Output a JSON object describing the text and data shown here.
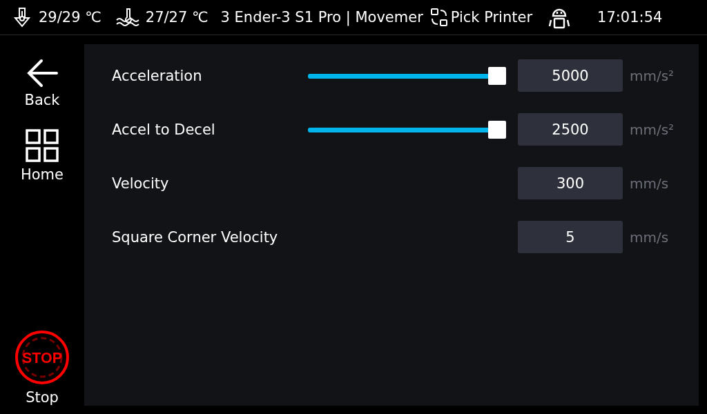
{
  "status_bar": {
    "extruder_temp": "29/29 ℃",
    "bed_temp": "27/27 ℃",
    "title": "3 Ender-3 S1 Pro | Movemer",
    "pick_printer": "Pick Printer",
    "time": "17:01:54"
  },
  "sidebar": [
    {
      "kind": "back",
      "label": "Back"
    },
    {
      "kind": "home",
      "label": "Home"
    },
    {
      "kind": "stop",
      "label": "Stop",
      "sign": "STOP"
    }
  ],
  "settings": [
    {
      "kind": "slider",
      "label": "Acceleration",
      "level": 1.0,
      "value": "5000",
      "unit": "mm/s²"
    },
    {
      "kind": "slider",
      "label": "Accel to Decel",
      "level": 1.0,
      "value": "2500",
      "unit": "mm/s²"
    },
    {
      "kind": "plain",
      "label": "Velocity",
      "value": "300",
      "unit": "mm/s"
    },
    {
      "kind": "plain",
      "label": "Square Corner Velocity",
      "value": "5",
      "unit": "mm/s"
    }
  ]
}
